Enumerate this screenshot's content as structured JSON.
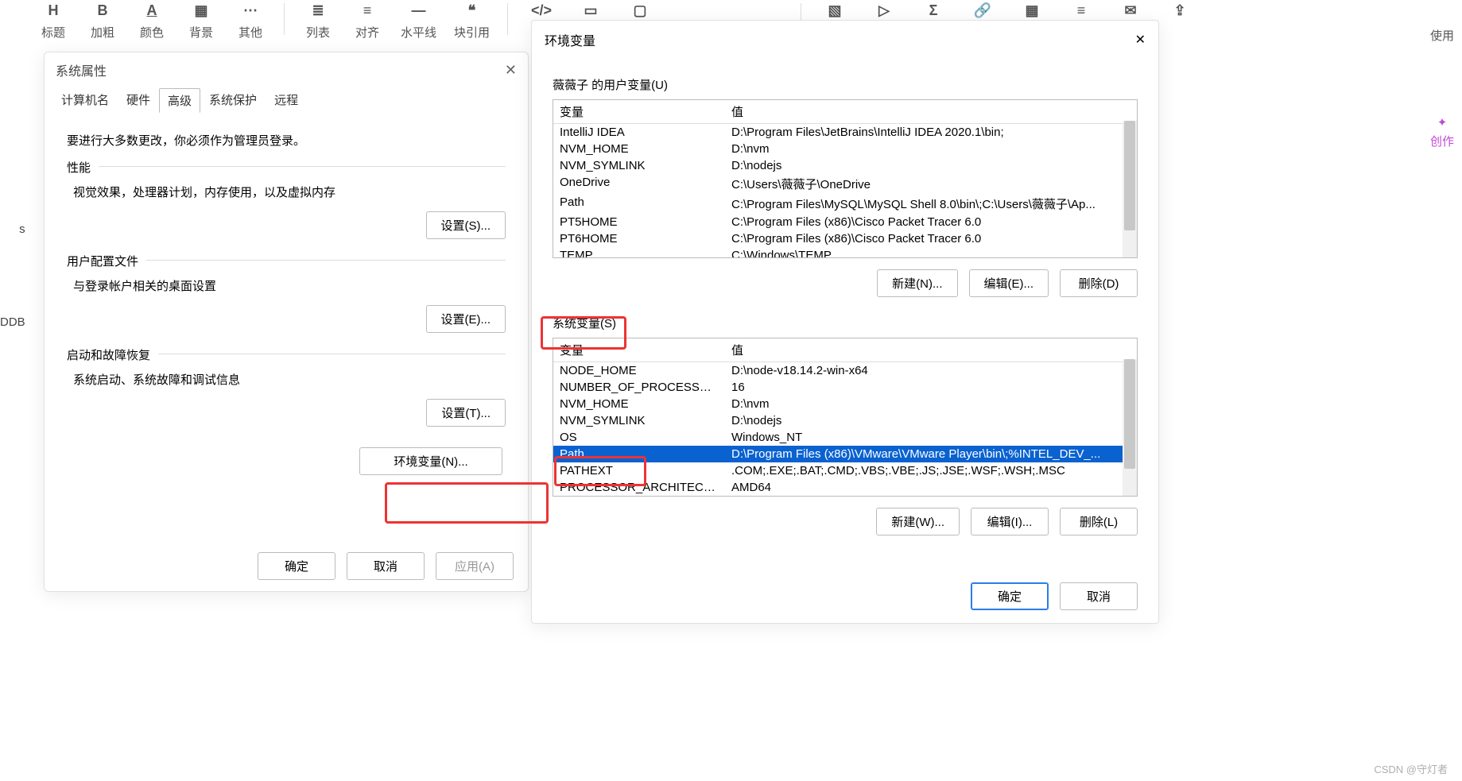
{
  "toolbar": {
    "items": [
      {
        "icon": "H",
        "label": "标题"
      },
      {
        "icon": "B",
        "label": "加粗"
      },
      {
        "icon": "A",
        "label": "颜色"
      },
      {
        "icon": "▦",
        "label": "背景"
      },
      {
        "icon": "⋯",
        "label": "其他"
      },
      {
        "sep": true
      },
      {
        "icon": "≣",
        "label": "列表"
      },
      {
        "icon": "≡",
        "label": "对齐"
      },
      {
        "icon": "—",
        "label": "水平线"
      },
      {
        "icon": "❝",
        "label": "块引用"
      },
      {
        "sep": true
      },
      {
        "icon": "</>",
        "label": ""
      },
      {
        "icon": "▭",
        "label": ""
      },
      {
        "icon": "▢",
        "label": ""
      },
      {
        "sep": true
      },
      {
        "icon": "▧",
        "label": ""
      },
      {
        "icon": "▷",
        "label": ""
      },
      {
        "icon": "Σ",
        "label": ""
      },
      {
        "icon": "🔗",
        "label": ""
      },
      {
        "icon": "▦",
        "label": ""
      },
      {
        "icon": "≡",
        "label": ""
      },
      {
        "icon": "✉",
        "label": ""
      },
      {
        "icon": "⇪",
        "label": ""
      }
    ]
  },
  "right_fragment": {
    "label": "使用",
    "create": "创作"
  },
  "left_fragment": {
    "a": "s",
    "b": "DDB"
  },
  "dlg1": {
    "title": "系统属性",
    "tabs": [
      "计算机名",
      "硬件",
      "高级",
      "系统保护",
      "远程"
    ],
    "active_tab": "高级",
    "note": "要进行大多数更改，你必须作为管理员登录。",
    "groups": [
      {
        "title": "性能",
        "desc": "视觉效果，处理器计划，内存使用，以及虚拟内存",
        "btn": "设置(S)..."
      },
      {
        "title": "用户配置文件",
        "desc": "与登录帐户相关的桌面设置",
        "btn": "设置(E)..."
      },
      {
        "title": "启动和故障恢复",
        "desc": "系统启动、系统故障和调试信息",
        "btn": "设置(T)..."
      }
    ],
    "env_btn": "环境变量(N)...",
    "footer": {
      "ok": "确定",
      "cancel": "取消",
      "apply": "应用(A)"
    }
  },
  "dlg2": {
    "title": "环境变量",
    "user_section_title": "薇薇子 的用户变量(U)",
    "headers": {
      "var": "变量",
      "val": "值"
    },
    "user_vars": [
      {
        "var": "IntelliJ IDEA",
        "val": "D:\\Program Files\\JetBrains\\IntelliJ IDEA 2020.1\\bin;"
      },
      {
        "var": "NVM_HOME",
        "val": "D:\\nvm"
      },
      {
        "var": "NVM_SYMLINK",
        "val": "D:\\nodejs"
      },
      {
        "var": "OneDrive",
        "val": "C:\\Users\\薇薇子\\OneDrive"
      },
      {
        "var": "Path",
        "val": "C:\\Program Files\\MySQL\\MySQL Shell 8.0\\bin\\;C:\\Users\\薇薇子\\Ap..."
      },
      {
        "var": "PT5HOME",
        "val": "C:\\Program Files (x86)\\Cisco Packet Tracer 6.0"
      },
      {
        "var": "PT6HOME",
        "val": "C:\\Program Files (x86)\\Cisco Packet Tracer 6.0"
      },
      {
        "var": "TEMP",
        "val": "C:\\Windows\\TEMP"
      }
    ],
    "user_btns": {
      "new": "新建(N)...",
      "edit": "编辑(E)...",
      "del": "删除(D)"
    },
    "sys_section_title": "系统变量(S)",
    "sys_vars": [
      {
        "var": "NODE_HOME",
        "val": "D:\\node-v18.14.2-win-x64"
      },
      {
        "var": "NUMBER_OF_PROCESSORS",
        "val": "16"
      },
      {
        "var": "NVM_HOME",
        "val": "D:\\nvm"
      },
      {
        "var": "NVM_SYMLINK",
        "val": "D:\\nodejs"
      },
      {
        "var": "OS",
        "val": "Windows_NT"
      },
      {
        "var": "Path",
        "val": "D:\\Program Files (x86)\\VMware\\VMware Player\\bin\\;%INTEL_DEV_...",
        "selected": true
      },
      {
        "var": "PATHEXT",
        "val": ".COM;.EXE;.BAT;.CMD;.VBS;.VBE;.JS;.JSE;.WSF;.WSH;.MSC"
      },
      {
        "var": "PROCESSOR_ARCHITECTURE",
        "val": "AMD64"
      }
    ],
    "sys_btns": {
      "new": "新建(W)...",
      "edit": "编辑(I)...",
      "del": "删除(L)"
    },
    "footer": {
      "ok": "确定",
      "cancel": "取消"
    }
  },
  "watermark": "CSDN @守灯者"
}
